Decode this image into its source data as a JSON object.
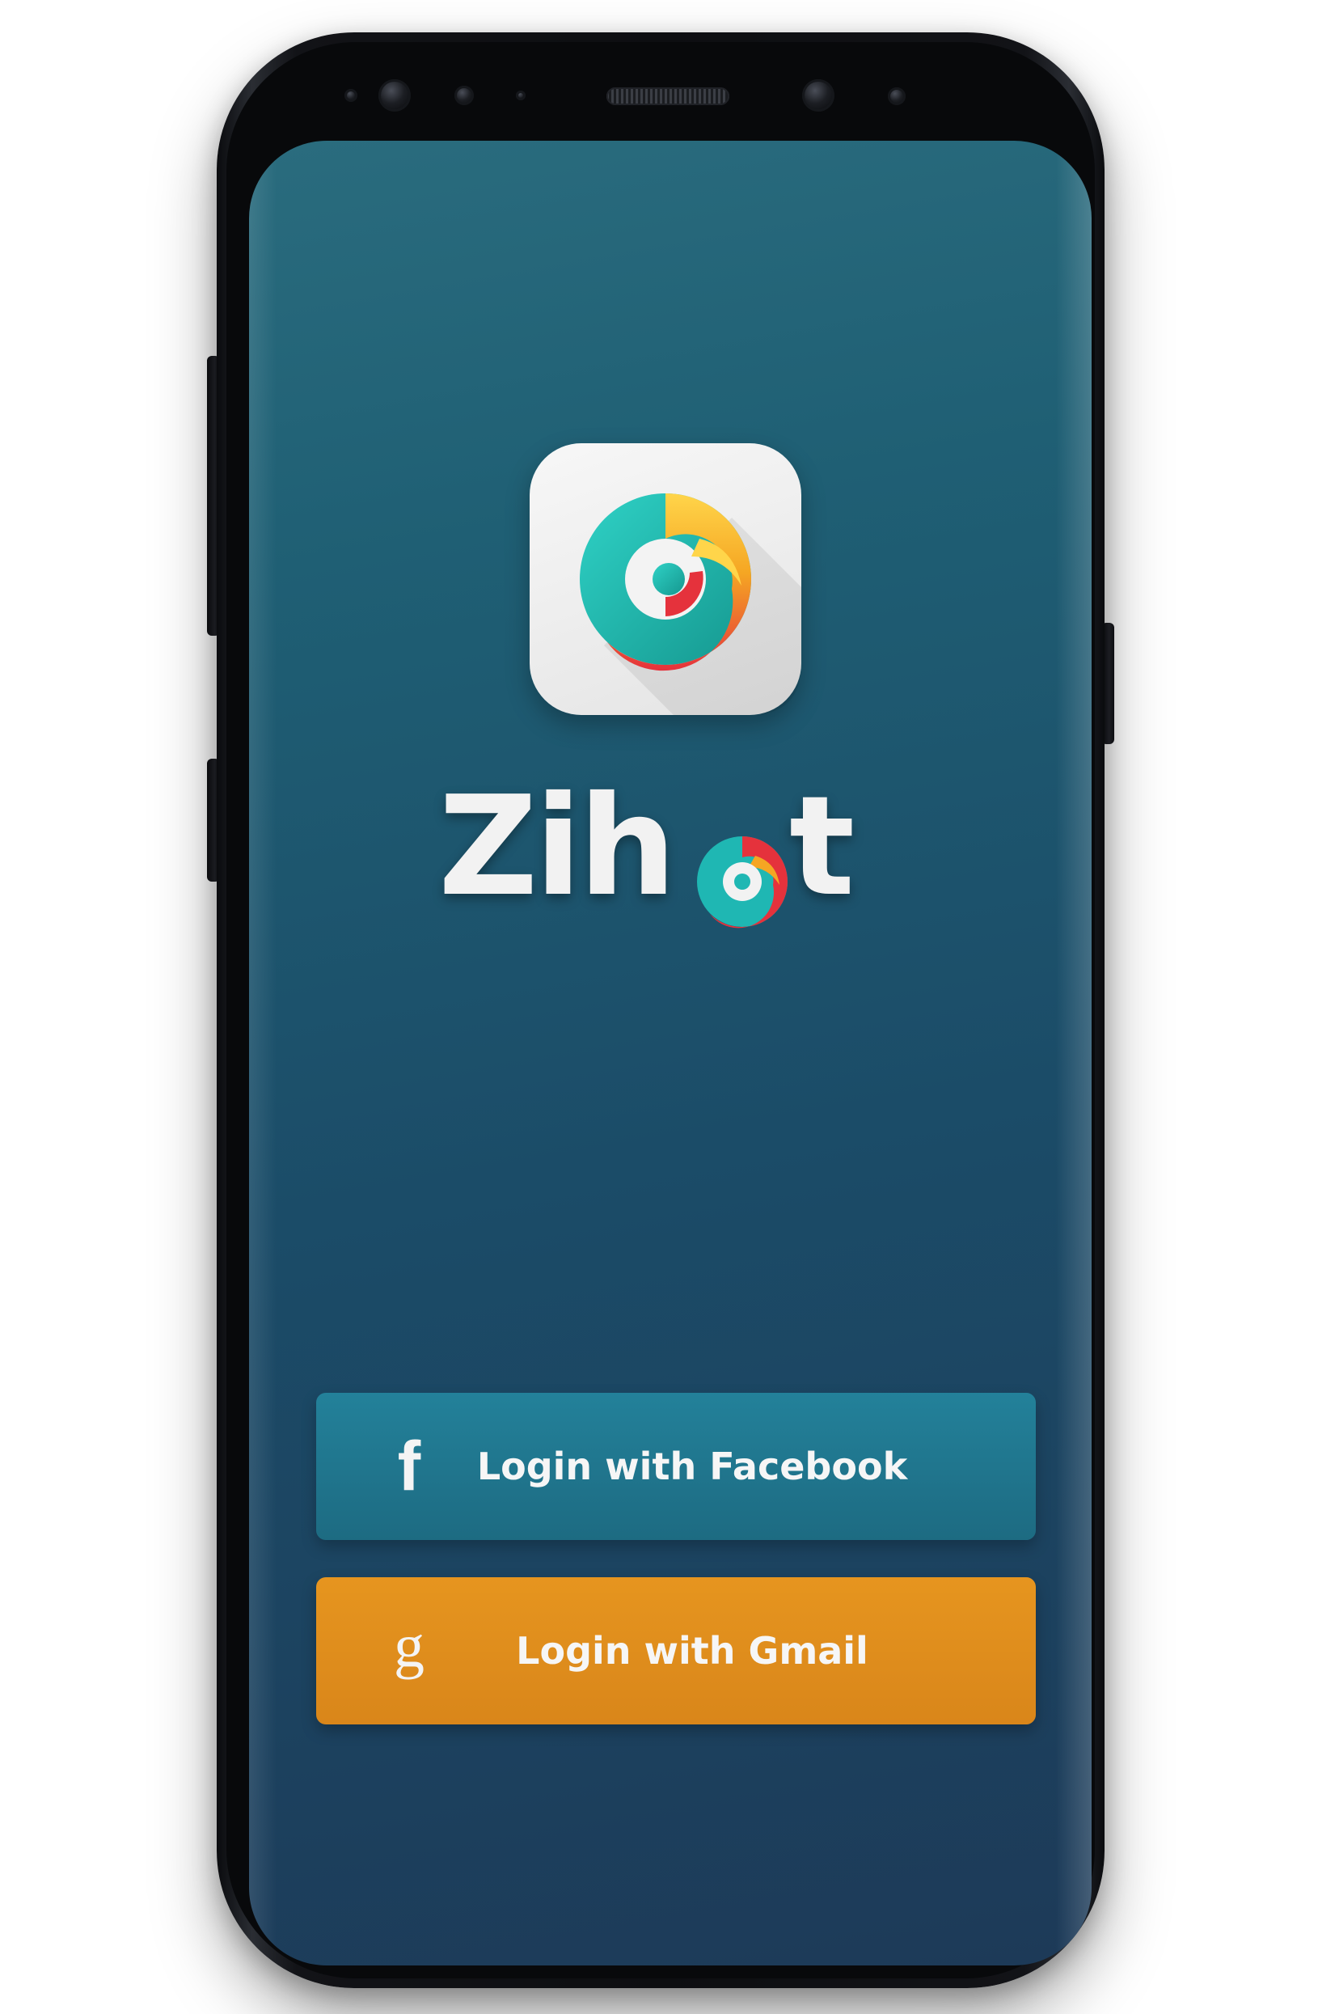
{
  "app": {
    "name": "Zihot",
    "wordmark_prefix": "Zih",
    "wordmark_suffix": "t"
  },
  "logo": {
    "icon_name": "zihot-logo-icon",
    "colors": {
      "teal": "#1fb7b3",
      "red": "#e5323c",
      "orange": "#f5a623",
      "yellow": "#ffd54a"
    }
  },
  "buttons": {
    "facebook": {
      "label": "Login with Facebook",
      "icon_glyph": "f",
      "icon_name": "facebook-icon",
      "color": "#21758b"
    },
    "gmail": {
      "label": "Login with Gmail",
      "icon_glyph": "g",
      "icon_name": "google-icon",
      "color": "#e08e1f"
    }
  },
  "theme": {
    "screen_top": "#2a6c7e",
    "screen_bottom": "#1d3a58",
    "device_frame": "#0d0e11"
  }
}
